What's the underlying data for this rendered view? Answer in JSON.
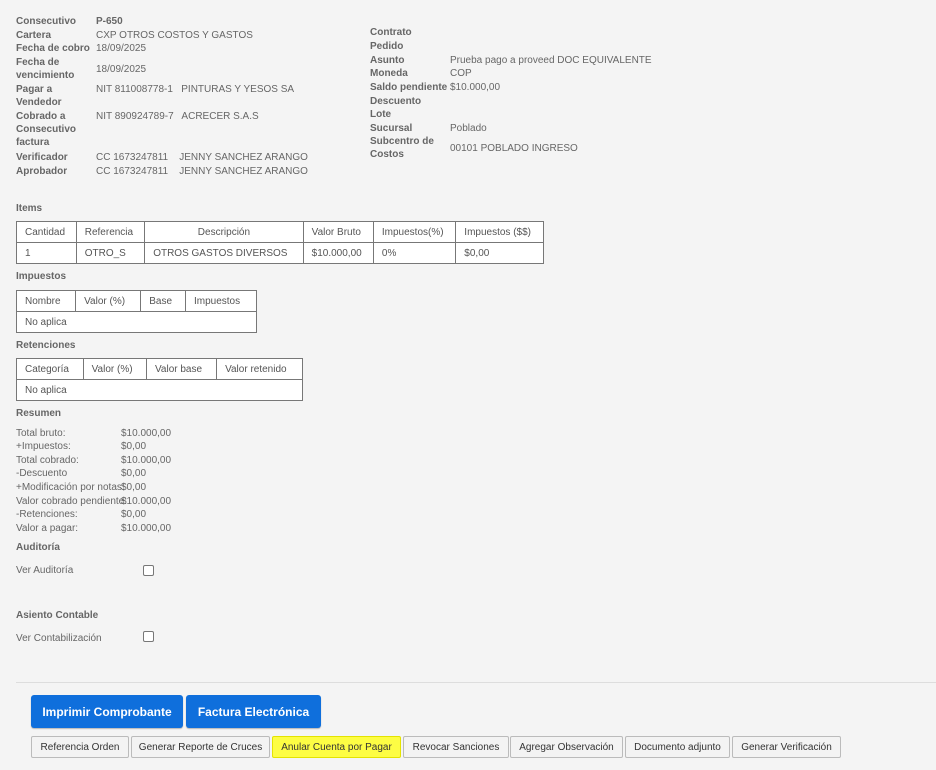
{
  "header_left": [
    {
      "label": "Consecutivo",
      "value": "P-650"
    },
    {
      "label": "Cartera",
      "value": "CXP OTROS COSTOS Y GASTOS"
    },
    {
      "label": "Fecha de cobro",
      "value": "18/09/2025"
    },
    {
      "label": "Fecha de vencimiento",
      "value": "18/09/2025"
    },
    {
      "label": "Pagar a Vendedor",
      "value": "NIT 811008778-1   PINTURAS Y YESOS SA"
    },
    {
      "label": "Cobrado a Consecutivo factura",
      "value": "NIT 890924789-7   ACRECER S.A.S"
    },
    {
      "label": "Verificador",
      "value": "CC 1673247811    JENNY SANCHEZ ARANGO"
    },
    {
      "label": "Aprobador",
      "value": "CC 1673247811    JENNY SANCHEZ ARANGO"
    }
  ],
  "header_right": [
    {
      "label": "Contrato",
      "value": ""
    },
    {
      "label": "Pedido",
      "value": ""
    },
    {
      "label": "Asunto",
      "value": "Prueba pago a proveed DOC EQUIVALENTE"
    },
    {
      "label": "Moneda",
      "value": "COP"
    },
    {
      "label": "Saldo pendiente",
      "value": "$10.000,00"
    },
    {
      "label": "Descuento",
      "value": ""
    },
    {
      "label": "Lote",
      "value": ""
    },
    {
      "label": "Sucursal",
      "value": "Poblado"
    },
    {
      "label": "Subcentro de Costos",
      "value": "00101 POBLADO INGRESO"
    }
  ],
  "items": {
    "title": "Items",
    "headers": [
      "Cantidad",
      "Referencia",
      "Descripción",
      "Valor Bruto",
      "Impuestos(%)",
      "Impuestos ($$)"
    ],
    "rows": [
      [
        "1",
        "OTRO_S",
        "OTROS GASTOS DIVERSOS",
        "$10.000,00",
        "0%",
        "$0,00"
      ]
    ]
  },
  "impuestos": {
    "title": "Impuestos",
    "headers": [
      "Nombre",
      "Valor (%)",
      "Base",
      "Impuestos"
    ],
    "empty": "No aplica"
  },
  "retenciones": {
    "title": "Retenciones",
    "headers": [
      "Categoría",
      "Valor (%)",
      "Valor base",
      "Valor retenido"
    ],
    "empty": "No aplica"
  },
  "resumen": {
    "title": "Resumen",
    "rows": [
      {
        "label": "Total bruto:",
        "value": "$10.000,00"
      },
      {
        "label": "+Impuestos:",
        "value": "$0,00"
      },
      {
        "label": "Total cobrado:",
        "value": "$10.000,00"
      },
      {
        "label": "-Descuento",
        "value": "$0,00"
      },
      {
        "label": "+Modificación por notas:",
        "value": "$0,00"
      },
      {
        "label": "Valor cobrado pendiente:",
        "value": "$10.000,00"
      },
      {
        "label": "-Retenciones:",
        "value": "$0,00"
      },
      {
        "label": "Valor a pagar:",
        "value": "$10.000,00"
      }
    ]
  },
  "auditoria": {
    "title": "Auditoría",
    "check_label": "Ver Auditoría",
    "checked": false
  },
  "asiento": {
    "title": "Asiento Contable",
    "check_label": "Ver Contabilización",
    "checked": false
  },
  "primary_buttons": [
    "Imprimir Comprobante",
    "Factura Electrónica"
  ],
  "secondary_buttons": [
    "Referencia Orden",
    "Generar Reporte de Cruces",
    "Anular Cuenta por Pagar",
    "Revocar Sanciones",
    "Agregar Observación",
    "Documento adjunto",
    "Generar Verificación"
  ],
  "colors": {
    "primary": "#0f6fdc",
    "highlight": "#fdfd44"
  }
}
